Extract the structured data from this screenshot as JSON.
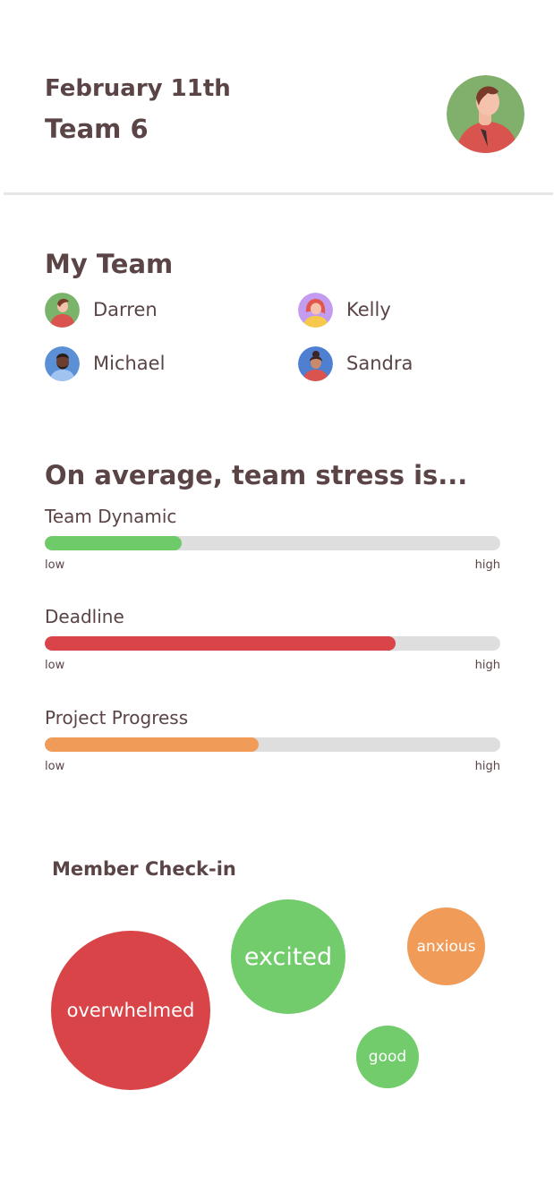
{
  "header": {
    "date": "February 11th",
    "team": "Team 6",
    "profile_avatar": "user-avatar-icon"
  },
  "my_team": {
    "title": "My Team",
    "members": [
      {
        "name": "Darren",
        "icon": "darren-avatar-icon",
        "bg": "#7ab36a"
      },
      {
        "name": "Kelly",
        "icon": "kelly-avatar-icon",
        "bg": "#c39cf2"
      },
      {
        "name": "Michael",
        "icon": "michael-avatar-icon",
        "bg": "#5b8fd6"
      },
      {
        "name": "Sandra",
        "icon": "sandra-avatar-icon",
        "bg": "#4f7fd0"
      }
    ]
  },
  "stress": {
    "title": "On average, team stress is...",
    "metrics": [
      {
        "label": "Team Dynamic",
        "level": 0.3,
        "color": "#6fcb6a",
        "low": "low",
        "high": "high"
      },
      {
        "label": "Deadline",
        "level": 0.77,
        "color": "#d94448",
        "low": "low",
        "high": "high"
      },
      {
        "label": "Project Progress",
        "level": 0.47,
        "color": "#f09b58",
        "low": "low",
        "high": "high"
      }
    ]
  },
  "checkin": {
    "title": "Member Check-in",
    "bubbles": [
      {
        "label": "overwhelmed",
        "color": "#d94448"
      },
      {
        "label": "excited",
        "color": "#72cc6c"
      },
      {
        "label": "anxious",
        "color": "#f09b58"
      },
      {
        "label": "good",
        "color": "#72cc6c"
      }
    ]
  }
}
